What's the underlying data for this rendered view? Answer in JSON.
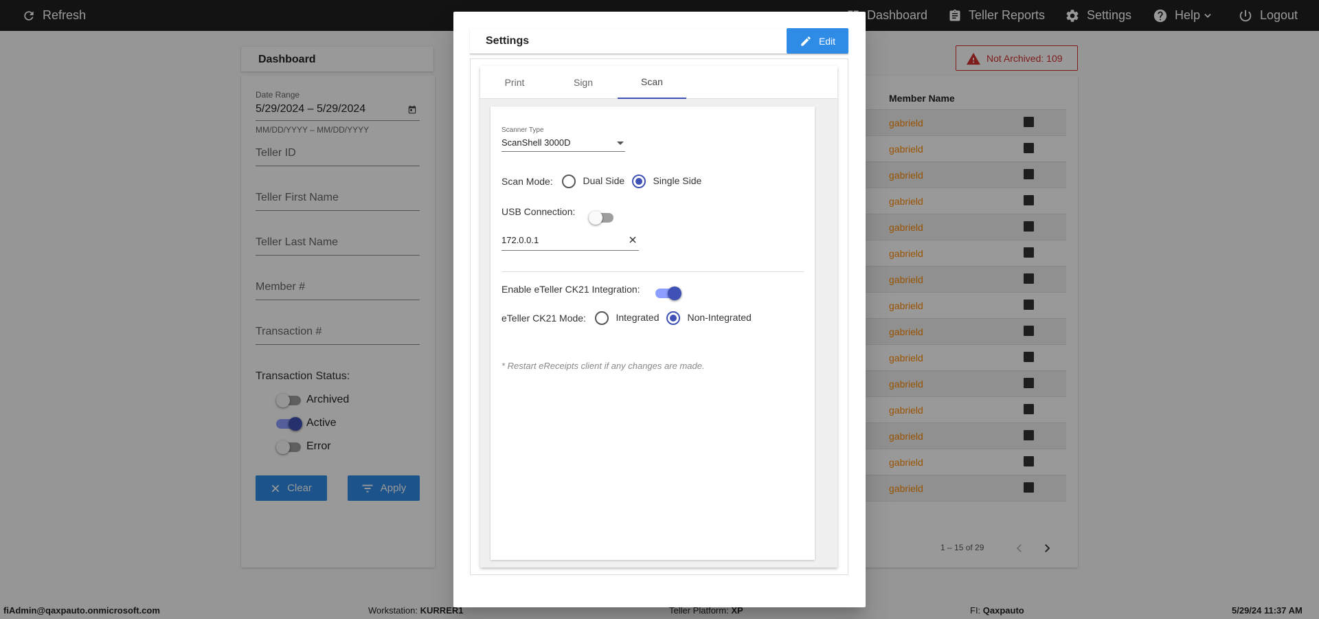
{
  "topbar": {
    "refresh_label": "Refresh",
    "nav": [
      {
        "label": "Dashboard",
        "icon": "dashboard-icon"
      },
      {
        "label": "Teller Reports",
        "icon": "clipboard-icon"
      },
      {
        "label": "Settings",
        "icon": "gear-icon"
      },
      {
        "label": "Help",
        "icon": "help-icon"
      },
      {
        "label": "Logout",
        "icon": "power-icon"
      }
    ]
  },
  "dashboard": {
    "title": "Dashboard",
    "filters": {
      "date_range_label": "Date Range",
      "date_range_value": "5/29/2024 – 5/29/2024",
      "date_range_hint": "MM/DD/YYYY – MM/DD/YYYY",
      "teller_id": "Teller ID",
      "teller_first_name": "Teller First Name",
      "teller_last_name": "Teller Last Name",
      "member_no": "Member #",
      "transaction_no": "Transaction #",
      "status_label": "Transaction Status:",
      "statuses": [
        {
          "label": "Archived",
          "on": false
        },
        {
          "label": "Active",
          "on": true
        },
        {
          "label": "Error",
          "on": false
        }
      ],
      "clear_label": "Clear",
      "apply_label": "Apply"
    },
    "alert": "Not Archived: 109",
    "table": {
      "column_member_name": "Member Name",
      "rows": [
        "gabrield",
        "gabrield",
        "gabrield",
        "gabrield",
        "gabrield",
        "gabrield",
        "gabrield",
        "gabrield",
        "gabrield",
        "gabrield",
        "gabrield",
        "gabrield",
        "gabrield",
        "gabrield",
        "gabrield"
      ],
      "pagination": "1 – 15 of 29"
    }
  },
  "statusbar": {
    "user": "fiAdmin@qaxpauto.onmicrosoft.com",
    "workstation_label": "Workstation:",
    "workstation": "KURRER1",
    "platform_label": "Teller Platform:",
    "platform": "XP",
    "fi_label": "FI:",
    "fi": "Qaxpauto",
    "datetime": "5/29/24 11:37 AM"
  },
  "modal": {
    "title": "Settings",
    "edit_label": "Edit",
    "tabs": [
      "Print",
      "Sign",
      "Scan"
    ],
    "active_tab": "Scan",
    "scan": {
      "scanner_type_label": "Scanner Type",
      "scanner_type_value": "ScanShell 3000D",
      "scan_mode_label": "Scan Mode:",
      "scan_mode_options": [
        "Dual Side",
        "Single Side"
      ],
      "scan_mode_selected": "Single Side",
      "usb_label": "USB Connection:",
      "usb_on": false,
      "ip_value": "172.0.0.1",
      "ck21_label": "Enable eTeller CK21 Integration:",
      "ck21_on": true,
      "ck21_mode_label": "eTeller CK21 Mode:",
      "ck21_mode_options": [
        "Integrated",
        "Non-Integrated"
      ],
      "ck21_mode_selected": "Non-Integrated",
      "note": "* Restart eReceipts client if any changes are made."
    }
  }
}
